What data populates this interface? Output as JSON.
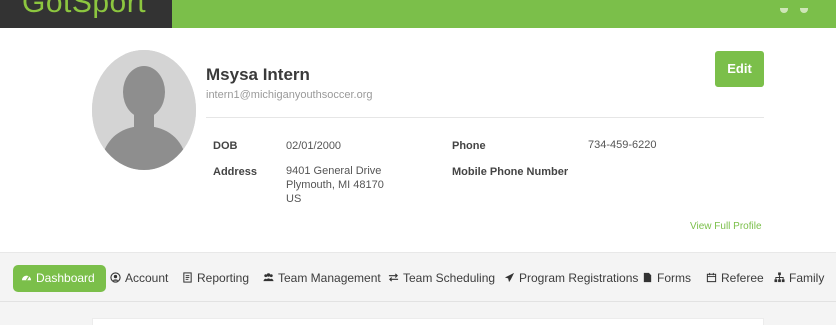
{
  "header": {
    "brand_text": "GotSport",
    "brand_color": "#8cc63f",
    "bar_color": "#7bbf4a"
  },
  "profile": {
    "name": "Msysa Intern",
    "email": "intern1@michiganyouthsoccer.org",
    "edit_label": "Edit",
    "dob_label": "DOB",
    "dob_value": "02/01/2000",
    "phone_label": "Phone",
    "phone_value": "734-459-6220",
    "address_label": "Address",
    "address_line1": "9401 General Drive",
    "address_line2": "Plymouth, MI 48170",
    "address_line3": "US",
    "mobile_label": "Mobile Phone Number",
    "view_full_profile": "View Full Profile"
  },
  "nav": {
    "items": [
      {
        "label": "Dashboard",
        "icon": "dashboard-icon"
      },
      {
        "label": "Account",
        "icon": "user-circle-icon"
      },
      {
        "label": "Reporting",
        "icon": "report-icon"
      },
      {
        "label": "Team Management",
        "icon": "users-icon"
      },
      {
        "label": "Team Scheduling",
        "icon": "exchange-icon"
      },
      {
        "label": "Program Registrations",
        "icon": "paper-plane-icon"
      },
      {
        "label": "Forms",
        "icon": "file-icon"
      },
      {
        "label": "Referee",
        "icon": "calendar-icon"
      },
      {
        "label": "Family",
        "icon": "sitemap-icon"
      }
    ],
    "active_index": 0,
    "accent": "#7bbf4a"
  }
}
